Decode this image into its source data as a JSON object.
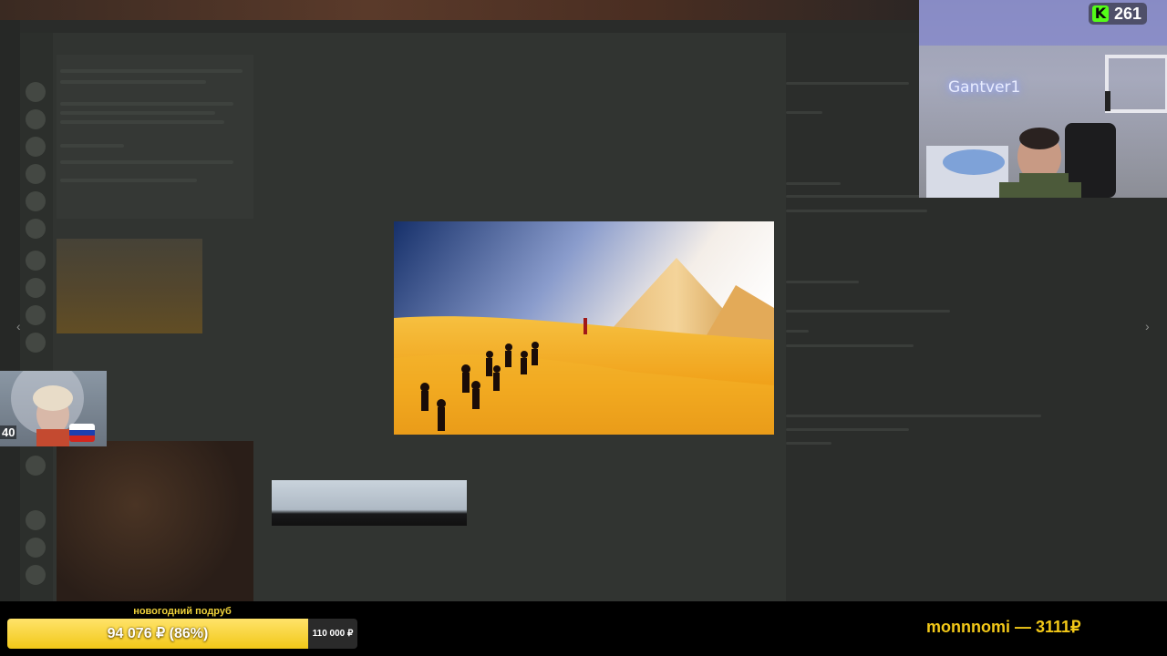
{
  "stream": {
    "viewer_count": "261",
    "viewer_icon": "kick-logo-icon",
    "streamer_sign": "Gantver1",
    "small_cam_number": "40",
    "small_cam_flag": "russia-flag-icon"
  },
  "lightbox": {
    "image_subject": "pyramids-desert-image",
    "prev_icon": "chevron-left-icon",
    "next_icon": "chevron-right-icon"
  },
  "donation_goal": {
    "title": "новогодний подруб",
    "current": "94 076 ₽ (86%)",
    "progress_percent": 86,
    "target": "110 000 ₽"
  },
  "donor_ticker": {
    "text": "monnnomi — 3111₽"
  },
  "colors": {
    "accent_yellow": "#f2c818",
    "kick_green": "#53fc18"
  }
}
